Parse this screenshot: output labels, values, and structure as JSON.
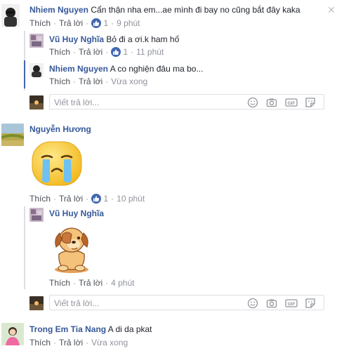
{
  "close_icon_glyph": "✕",
  "comments": {
    "c1": {
      "author": "Nhiem Nguyen",
      "text": "Cẩn thận nha em...ae mình đi bay no cũng bắt đây kaka",
      "like": "Thích",
      "reply": "Trả lời",
      "likes": "1",
      "time": "9 phút"
    },
    "r1": {
      "author": "Vũ Huy Nghĩa",
      "text": "Bỏ đi a ơi.k ham hố",
      "like": "Thích",
      "reply": "Trả lời",
      "likes": "1",
      "time": "11 phút"
    },
    "r2": {
      "author": "Nhiem Nguyen",
      "text": "A co nghiện đâu ma bo...",
      "like": "Thích",
      "reply": "Trả lời",
      "time": "Vừa xong"
    },
    "c2": {
      "author": "Nguyễn Hương",
      "like": "Thích",
      "reply": "Trả lời",
      "likes": "1",
      "time": "10 phút"
    },
    "r3": {
      "author": "Vũ Huy Nghĩa",
      "like": "Thích",
      "reply": "Trả lời",
      "time": "4 phút"
    },
    "c3": {
      "author": "Trong Em Tia Nang",
      "text": "A di da pkat",
      "like": "Thích",
      "reply": "Trả lời",
      "time": "Vừa xong"
    }
  },
  "reply_box": {
    "placeholder": "Viết trả lời..."
  },
  "sep": "·",
  "colors": {
    "link": "#365899",
    "like_blue": "#4267b2",
    "meta": "#90949c"
  }
}
